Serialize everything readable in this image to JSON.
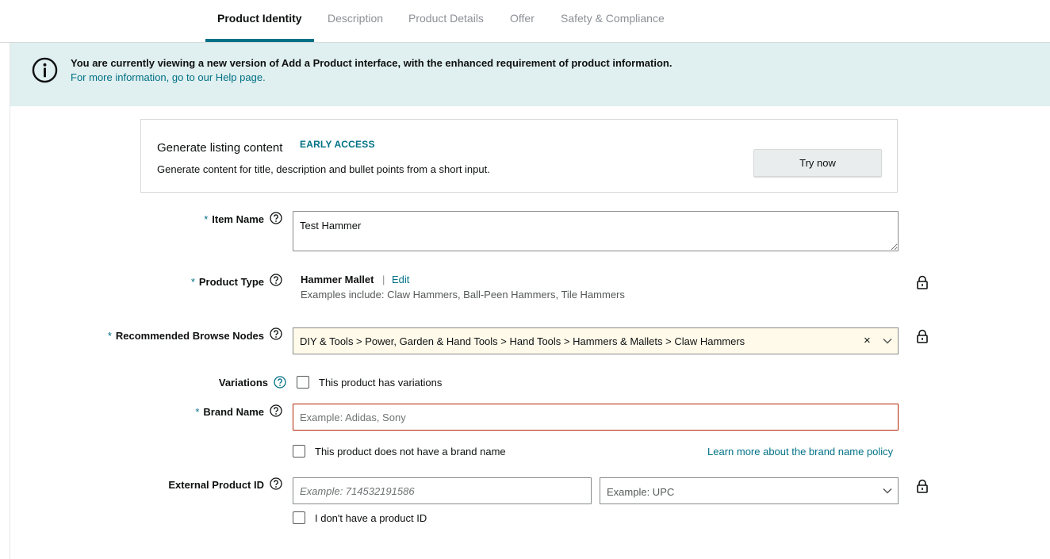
{
  "tabs": [
    {
      "label": "Product Identity",
      "active": true
    },
    {
      "label": "Description",
      "active": false
    },
    {
      "label": "Product Details",
      "active": false
    },
    {
      "label": "Offer",
      "active": false
    },
    {
      "label": "Safety & Compliance",
      "active": false
    }
  ],
  "banner": {
    "message": "You are currently viewing a new version of Add a Product interface, with the enhanced requirement of product information.",
    "help_link": "For more information, go to our Help page.",
    "icon": "info-icon"
  },
  "generate": {
    "title": "Generate listing content",
    "badge": "EARLY ACCESS",
    "description": "Generate content for title, description and bullet points from a short input.",
    "button": "Try now"
  },
  "form": {
    "required_marker": "*",
    "item_name": {
      "label": "Item Name",
      "value": "Test Hammer"
    },
    "product_type": {
      "label": "Product Type",
      "value": "Hammer Mallet",
      "separator": "|",
      "edit": "Edit",
      "examples": "Examples include: Claw Hammers, Ball-Peen Hammers, Tile Hammers"
    },
    "browse_nodes": {
      "label": "Recommended Browse Nodes",
      "value": "DIY & Tools > Power, Garden & Hand Tools > Hand Tools > Hammers & Mallets > Claw Hammers",
      "clear": "×"
    },
    "variations": {
      "label": "Variations",
      "checkbox_label": "This product has variations",
      "checked": false
    },
    "brand_name": {
      "label": "Brand Name",
      "placeholder": "Example: Adidas, Sony",
      "no_brand_label": "This product does not have a brand name",
      "learn_more": "Learn more about the brand name policy"
    },
    "external_id": {
      "label": "External Product ID",
      "placeholder": "Example: 714532191586",
      "type_placeholder": "Example: UPC",
      "no_id_label": "I don't have a product ID"
    }
  },
  "colors": {
    "accent": "#007185",
    "banner_bg": "#e0efef",
    "error_border": "#b12704",
    "highlight_bg": "#fffaea"
  }
}
